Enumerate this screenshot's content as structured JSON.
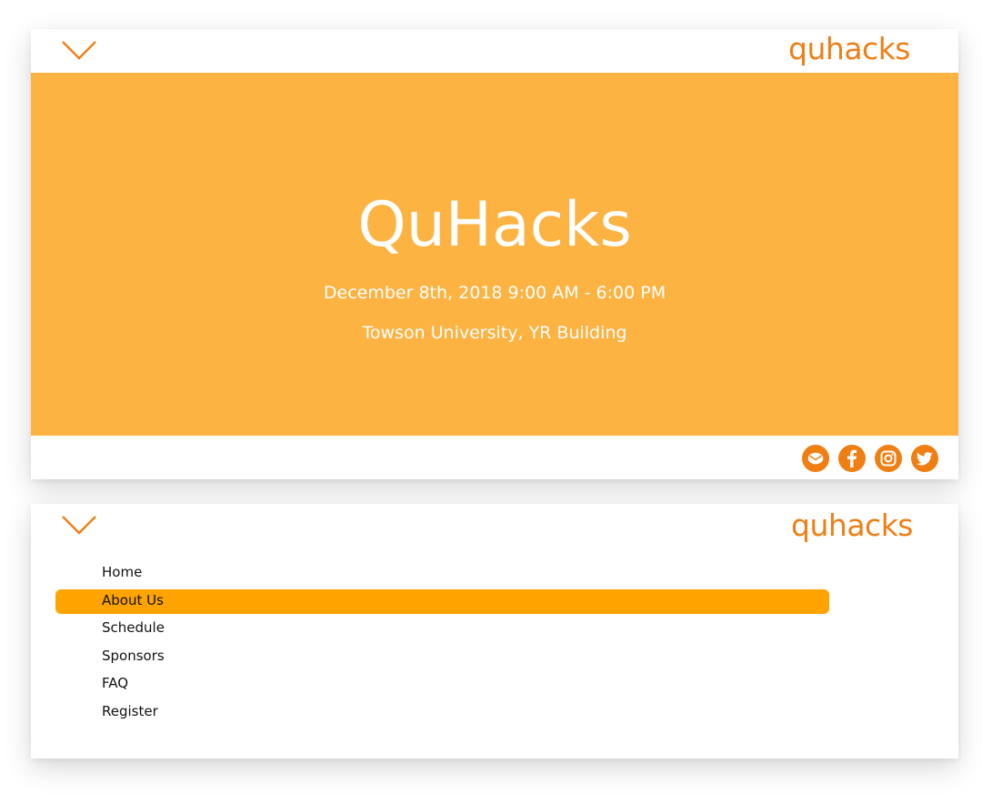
{
  "brand": {
    "logo_text": "quhacks",
    "accent_color": "#ee7f16",
    "hero_color": "#fcb342",
    "active_color": "#ffa300"
  },
  "hero": {
    "title": "QuHacks",
    "date": "December 8th, 2018 9:00 AM - 6:00 PM",
    "location": "Towson University, YR Building"
  },
  "header": {
    "menu_icon": "chevron-down-icon"
  },
  "social": [
    {
      "name": "email",
      "icon": "mail-icon"
    },
    {
      "name": "facebook",
      "icon": "facebook-icon"
    },
    {
      "name": "instagram",
      "icon": "instagram-icon"
    },
    {
      "name": "twitter",
      "icon": "twitter-icon"
    }
  ],
  "menu": {
    "items": [
      {
        "label": "Home"
      },
      {
        "label": "About Us"
      },
      {
        "label": "Schedule"
      },
      {
        "label": "Sponsors"
      },
      {
        "label": "FAQ"
      },
      {
        "label": "Register"
      }
    ],
    "active_label": "About Us"
  }
}
